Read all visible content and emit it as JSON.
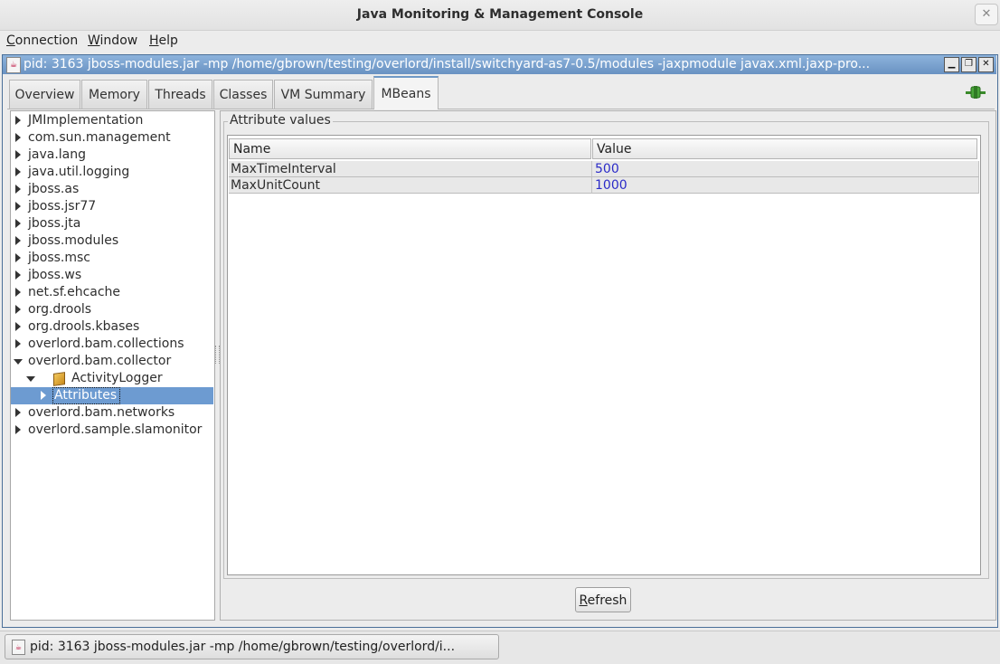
{
  "window": {
    "title": "Java Monitoring & Management Console",
    "close_glyph": "✕"
  },
  "menubar": {
    "connection": {
      "mnemonic": "C",
      "rest": "onnection"
    },
    "window": {
      "mnemonic": "W",
      "rest": "indow"
    },
    "help": {
      "mnemonic": "H",
      "rest": "elp"
    }
  },
  "internal_frame": {
    "title": "pid: 3163 jboss-modules.jar -mp /home/gbrown/testing/overlord/install/switchyard-as7-0.5/modules -jaxpmodule javax.xml.jaxp-pro..."
  },
  "tabs": [
    {
      "label": "Overview"
    },
    {
      "label": "Memory"
    },
    {
      "label": "Threads"
    },
    {
      "label": "Classes"
    },
    {
      "label": "VM Summary"
    },
    {
      "label": "MBeans",
      "active": true
    }
  ],
  "tree": [
    {
      "label": "JMImplementation",
      "state": "collapsed",
      "level": 0
    },
    {
      "label": "com.sun.management",
      "state": "collapsed",
      "level": 0
    },
    {
      "label": "java.lang",
      "state": "collapsed",
      "level": 0
    },
    {
      "label": "java.util.logging",
      "state": "collapsed",
      "level": 0
    },
    {
      "label": "jboss.as",
      "state": "collapsed",
      "level": 0
    },
    {
      "label": "jboss.jsr77",
      "state": "collapsed",
      "level": 0
    },
    {
      "label": "jboss.jta",
      "state": "collapsed",
      "level": 0
    },
    {
      "label": "jboss.modules",
      "state": "collapsed",
      "level": 0
    },
    {
      "label": "jboss.msc",
      "state": "collapsed",
      "level": 0
    },
    {
      "label": "jboss.ws",
      "state": "collapsed",
      "level": 0
    },
    {
      "label": "net.sf.ehcache",
      "state": "collapsed",
      "level": 0
    },
    {
      "label": "org.drools",
      "state": "collapsed",
      "level": 0
    },
    {
      "label": "org.drools.kbases",
      "state": "collapsed",
      "level": 0
    },
    {
      "label": "overlord.bam.collections",
      "state": "collapsed",
      "level": 0
    },
    {
      "label": "overlord.bam.collector",
      "state": "expanded",
      "level": 0
    },
    {
      "label": "ActivityLogger",
      "state": "expanded",
      "level": 1,
      "icon": "bean-icon"
    },
    {
      "label": "Attributes",
      "state": "collapsed",
      "level": 2,
      "selected": true
    },
    {
      "label": "overlord.bam.networks",
      "state": "collapsed",
      "level": 0
    },
    {
      "label": "overlord.sample.slamonitor",
      "state": "collapsed",
      "level": 0
    }
  ],
  "attributes_panel": {
    "group_label": "Attribute values",
    "columns": [
      "Name",
      "Value"
    ],
    "rows": [
      {
        "name": "MaxTimeInterval",
        "value": "500"
      },
      {
        "name": "MaxUnitCount",
        "value": "1000"
      }
    ],
    "refresh": {
      "mnemonic": "R",
      "rest": "efresh"
    }
  },
  "taskbar": {
    "item_label": "pid: 3163 jboss-modules.jar -mp /home/gbrown/testing/overlord/i..."
  },
  "colors": {
    "selection": "#6d9bd1",
    "value_text": "#2b2bc8",
    "frame_title": "#7aa2cf"
  }
}
